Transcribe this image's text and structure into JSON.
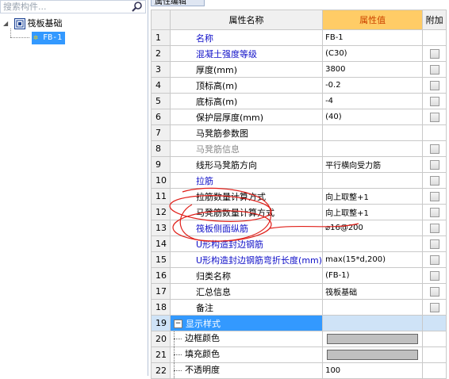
{
  "search": {
    "placeholder": "搜索构件..."
  },
  "tree": {
    "root_label": "筏板基础",
    "child_label": "FB-1"
  },
  "panel_tab": "属性编辑",
  "grid": {
    "headers": {
      "num": "",
      "name": "属性名称",
      "value": "属性值",
      "extra": "附加"
    },
    "rows": [
      {
        "num": "1",
        "name": "名称",
        "value": "FB-1",
        "style": "blue",
        "check": false
      },
      {
        "num": "2",
        "name": "混凝土强度等级",
        "value": "(C30)",
        "style": "blue",
        "check": true
      },
      {
        "num": "3",
        "name": "厚度(mm)",
        "value": "3800",
        "style": "",
        "check": true
      },
      {
        "num": "4",
        "name": "顶标高(m)",
        "value": "-0.2",
        "style": "",
        "check": true
      },
      {
        "num": "5",
        "name": "底标高(m)",
        "value": "-4",
        "style": "",
        "check": true
      },
      {
        "num": "6",
        "name": "保护层厚度(mm)",
        "value": "(40)",
        "style": "",
        "check": true
      },
      {
        "num": "7",
        "name": "马凳筋参数图",
        "value": "",
        "style": "",
        "check": false
      },
      {
        "num": "8",
        "name": "马凳筋信息",
        "value": "",
        "style": "gray",
        "check": true
      },
      {
        "num": "9",
        "name": "线形马凳筋方向",
        "value": "平行横向受力筋",
        "style": "",
        "check": true
      },
      {
        "num": "10",
        "name": "拉筋",
        "value": "",
        "style": "blue",
        "check": true
      },
      {
        "num": "11",
        "name": "拉筋数量计算方式",
        "value": "向上取整+1",
        "style": "",
        "check": true
      },
      {
        "num": "12",
        "name": "马凳筋数量计算方式",
        "value": "向上取整+1",
        "style": "",
        "check": true
      },
      {
        "num": "13",
        "name": "筏板侧面纵筋",
        "value": "⌀16@200",
        "style": "blue",
        "check": true
      },
      {
        "num": "14",
        "name": "U形构造封边钢筋",
        "value": "",
        "style": "blue",
        "check": true
      },
      {
        "num": "15",
        "name": "U形构造封边钢筋弯折长度(mm)",
        "value": "max(15*d,200)",
        "style": "blue",
        "check": true
      },
      {
        "num": "16",
        "name": "归类名称",
        "value": "(FB-1)",
        "style": "",
        "check": true
      },
      {
        "num": "17",
        "name": "汇总信息",
        "value": "筏板基础",
        "style": "",
        "check": true
      },
      {
        "num": "18",
        "name": "备注",
        "value": "",
        "style": "",
        "check": true
      },
      {
        "num": "19",
        "name": "显示样式",
        "value": "",
        "style": "group",
        "check": false
      },
      {
        "num": "20",
        "name": "边框颜色",
        "value": "",
        "style": "color",
        "check": false
      },
      {
        "num": "21",
        "name": "填充颜色",
        "value": "",
        "style": "color",
        "check": false
      },
      {
        "num": "22",
        "name": "不透明度",
        "value": "100",
        "style": "sub",
        "check": false
      }
    ]
  },
  "colors": {
    "selection": "#3399ff",
    "value_header_bg": "#ffcc66",
    "link_text": "#1010c8",
    "annotation_ink": "#e0201a"
  }
}
